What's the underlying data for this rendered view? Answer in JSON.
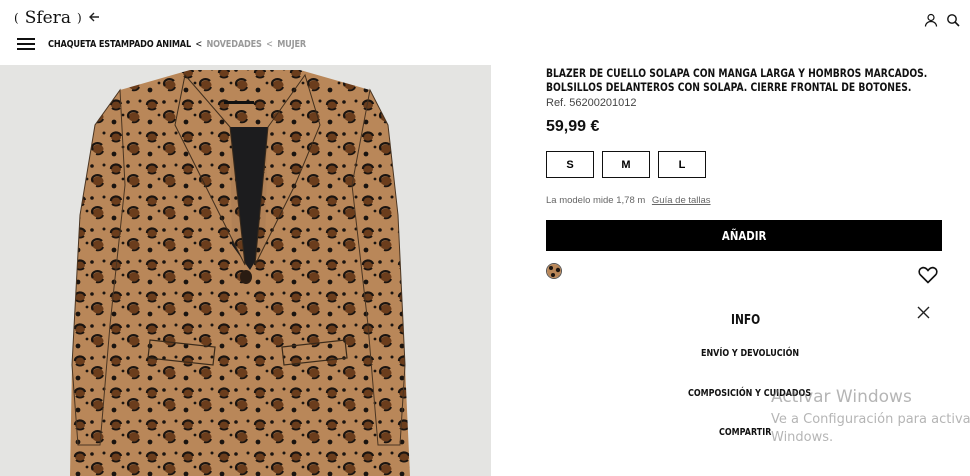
{
  "header": {
    "logo_text": "Sfera",
    "logo_paren_left": "(",
    "logo_paren_right": ")",
    "back_icon": "arrow-left-icon",
    "user_icon": "user-icon",
    "search_icon": "search-icon",
    "menu_icon": "hamburger-menu-icon"
  },
  "breadcrumb": {
    "current": "CHAQUETA ESTAMPADO ANIMAL",
    "separator": "<",
    "items": [
      "NOVEDADES",
      "MUJER"
    ]
  },
  "product": {
    "description_line1": "BLAZER DE CUELLO SOLAPA CON MANGA LARGA Y HOMBROS MARCADOS.",
    "description_line2": "BOLSILLOS DELANTEROS CON SOLAPA. CIERRE FRONTAL DE BOTONES.",
    "reference": "Ref. 56200201012",
    "price": "59,99 €",
    "sizes": [
      "S",
      "M",
      "L"
    ],
    "model_info": "La modelo mide 1,78 m",
    "size_guide_label": "Guía de tallas",
    "add_button_label": "AÑADIR",
    "swatch": "leopard-print",
    "accent_color": "#000000"
  },
  "info": {
    "title": "INFO",
    "links": [
      "ENVÍO Y DEVOLUCIÓN",
      "COMPOSICIÓN Y CUIDADOS",
      "COMPARTIR"
    ]
  },
  "watermark": {
    "title": "Activar Windows",
    "line1": "Ve a Configuración para activar",
    "line2": "Windows."
  }
}
